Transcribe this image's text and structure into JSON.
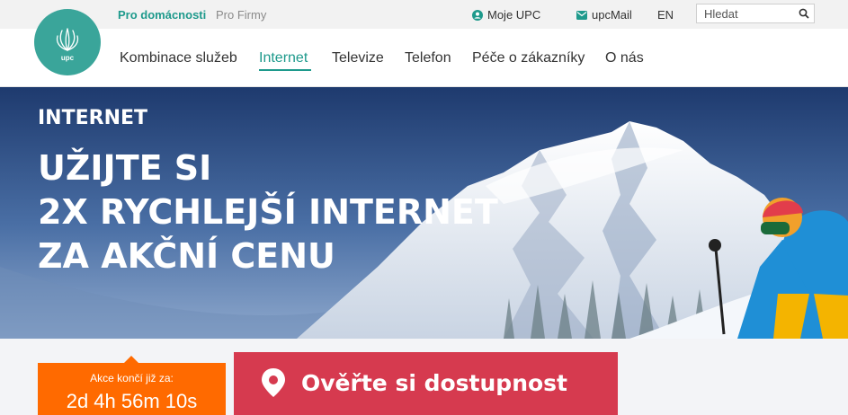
{
  "header": {
    "segments": {
      "home": "Pro domácnosti",
      "business": "Pro Firmy"
    },
    "utility": {
      "my_upc": "Moje UPC",
      "mail": "upcMail",
      "language": "EN"
    },
    "search": {
      "placeholder": "Hledat"
    }
  },
  "logo": {
    "text": "upc"
  },
  "nav": {
    "items": [
      {
        "label": "Kombinace služeb"
      },
      {
        "label": "Internet"
      },
      {
        "label": "Televize"
      },
      {
        "label": "Telefon"
      },
      {
        "label": "Péče o zákazníky"
      },
      {
        "label": "O nás"
      }
    ],
    "active_index": 1
  },
  "hero": {
    "eyebrow": "INTERNET",
    "headline": [
      "UŽIJTE SI",
      "2X RYCHLEJŠÍ INTERNET",
      "ZA AKČNÍ CENU"
    ]
  },
  "countdown": {
    "label": "Akce končí již za:",
    "time": "2d 4h 56m 10s"
  },
  "availability": {
    "label": "Ověřte si dostupnost"
  },
  "colors": {
    "brand_teal": "#1e9a8c",
    "orange": "#ff6a00",
    "red": "#d63a4f"
  },
  "icons": {
    "user": "user-circle-icon",
    "mail": "envelope-icon",
    "search": "search-icon",
    "pin": "location-pin-icon"
  }
}
